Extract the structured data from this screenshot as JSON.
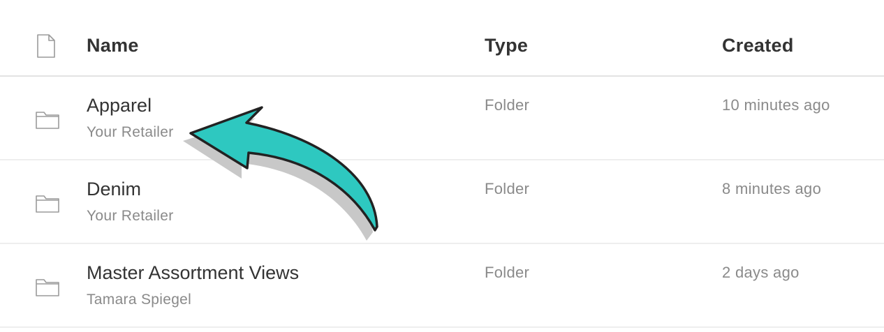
{
  "header": {
    "icon": "file-icon",
    "name_label": "Name",
    "type_label": "Type",
    "created_label": "Created"
  },
  "rows": [
    {
      "name": "Apparel",
      "owner": "Your Retailer",
      "type": "Folder",
      "created": "10 minutes ago",
      "icon": "folder-icon"
    },
    {
      "name": "Denim",
      "owner": "Your Retailer",
      "type": "Folder",
      "created": "8 minutes ago",
      "icon": "folder-icon"
    },
    {
      "name": "Master Assortment Views",
      "owner": "Tamara Spiegel",
      "type": "Folder",
      "created": "2 days ago",
      "icon": "folder-icon"
    }
  ],
  "annotation": {
    "icon": "curved-arrow-icon",
    "fill_color": "#2ec8c0",
    "stroke_color": "#222222",
    "shadow_color": "#c8c8c8"
  }
}
